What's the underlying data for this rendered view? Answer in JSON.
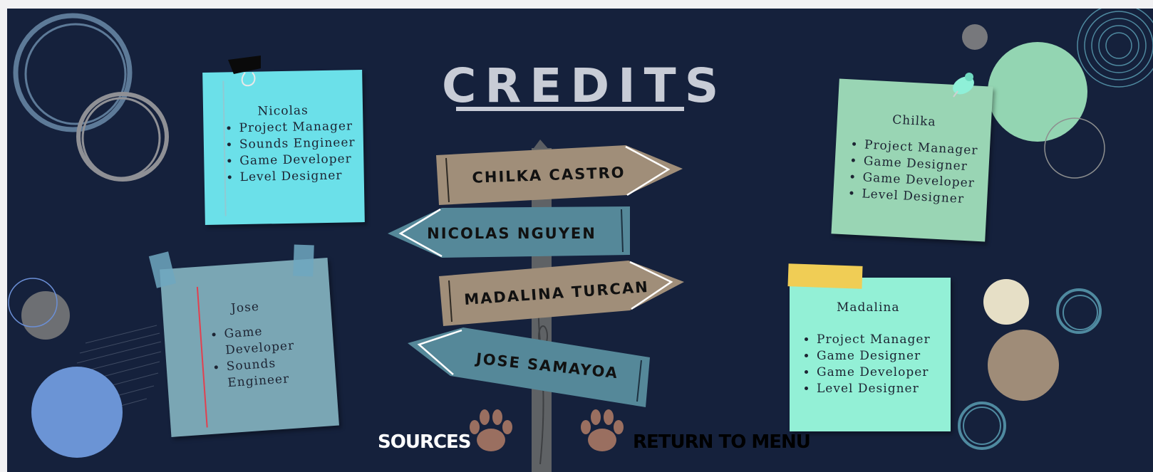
{
  "title": "CREDITS",
  "signs": [
    "CHILKA CASTRO",
    "NICOLAS NGUYEN",
    "MADALINA TURCAN",
    "JOSE SAMAYOA"
  ],
  "notes": {
    "nicolas": {
      "name": "Nicolas",
      "roles": [
        "Project Manager",
        "Sounds Engineer",
        "Game Developer",
        "Level Designer"
      ]
    },
    "chilka": {
      "name": "Chilka",
      "roles": [
        "Project Manager",
        "Game Designer",
        "Game Developer",
        "Level Designer"
      ]
    },
    "jose": {
      "name": "Jose",
      "roles": [
        "Game Developer",
        "Sounds Engineer"
      ]
    },
    "madalina": {
      "name": "Madalina",
      "roles": [
        "Project Manager",
        "Game Designer",
        "Game Developer",
        "Level Designer"
      ]
    }
  },
  "buttons": {
    "sources": "SOURCES",
    "return": "RETURN TO MENU"
  },
  "colors": {
    "background": "#15213c",
    "note_nicolas": "#6be0e9",
    "note_chilka": "#99d5b4",
    "note_jose": "#7aa6b4",
    "note_madalina": "#93f0d6",
    "sign_tan": "#a08e79",
    "sign_teal": "#558899",
    "paw": "#9a6f60"
  },
  "icons": [
    "binder-clip-icon",
    "push-pin-icon",
    "tape-icon",
    "paw-print-icon",
    "signpost-icon"
  ]
}
